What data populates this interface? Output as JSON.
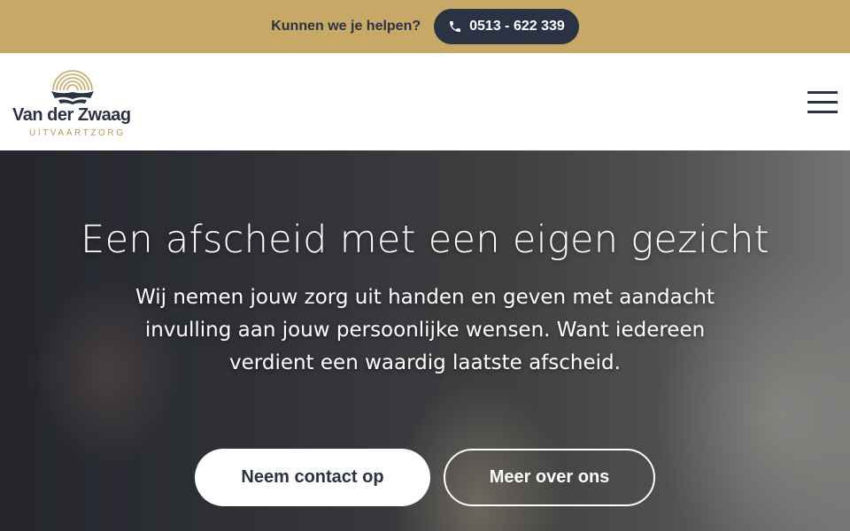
{
  "topbar": {
    "help_text": "Kunnen we je helpen?",
    "phone_label": "0513 - 622 339",
    "background": "#c8a866"
  },
  "header": {
    "logo_name": "Van der Zwaag",
    "logo_sub": "UITVAARTZORG",
    "menu_icon": "hamburger-icon"
  },
  "hero": {
    "title": "Een afscheid met een eigen gezicht",
    "text": "Wij nemen jouw zorg uit handen en geven met aandacht invulling aan jouw persoonlijke wensen. Want iedereen verdient een waardig laatste afscheid.",
    "primary_button": "Neem contact op",
    "secondary_button": "Meer over ons"
  },
  "colors": {
    "navy": "#2b3243",
    "gold": "#b9975a"
  }
}
